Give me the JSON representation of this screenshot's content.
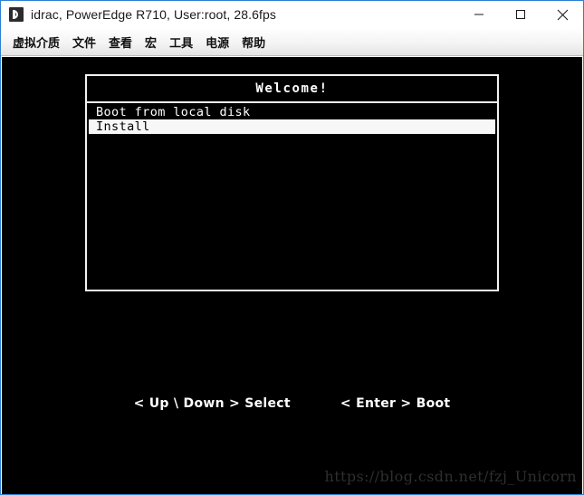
{
  "window": {
    "title": "idrac, PowerEdge R710, User:root, 28.6fps",
    "icon": "idrac-app-icon",
    "accent_border_color": "#2c7fd4",
    "controls": {
      "minimize_label": "─",
      "maximize_label": "□",
      "close_label": "✕"
    }
  },
  "menu": {
    "items": [
      {
        "label": "虚拟介质"
      },
      {
        "label": "文件"
      },
      {
        "label": "查看"
      },
      {
        "label": "宏"
      },
      {
        "label": "工具"
      },
      {
        "label": "电源"
      },
      {
        "label": "帮助"
      }
    ]
  },
  "console": {
    "background_color": "#000000",
    "foreground_color": "#ffffff",
    "dialog": {
      "title": "Welcome!",
      "entries": [
        {
          "label": "Boot from local disk",
          "selected": false
        },
        {
          "label": "Install",
          "selected": true
        }
      ]
    },
    "hints": [
      {
        "label": "< Up \\ Down > Select"
      },
      {
        "label": "< Enter > Boot"
      }
    ]
  },
  "watermark": {
    "text": "https://blog.csdn.net/fzj_Unicorn",
    "color": "#2f2f2f"
  }
}
